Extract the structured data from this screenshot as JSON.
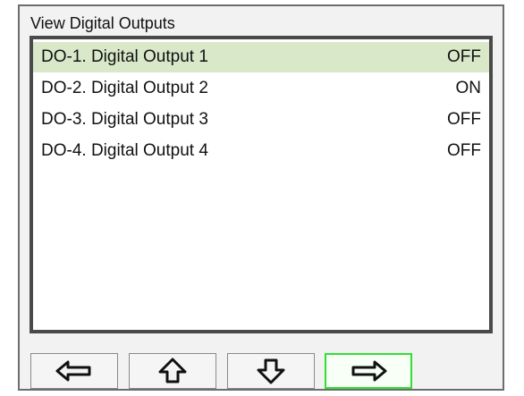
{
  "window": {
    "title": "View Digital Outputs"
  },
  "outputs": [
    {
      "name": "DO-1. Digital Output 1",
      "state": "OFF",
      "selected": true
    },
    {
      "name": "DO-2. Digital Output 2",
      "state": "ON",
      "selected": false
    },
    {
      "name": "DO-3. Digital Output 3",
      "state": "OFF",
      "selected": false
    },
    {
      "name": "DO-4. Digital Output 4",
      "state": "OFF",
      "selected": false
    }
  ],
  "toolbar": {
    "buttons": [
      {
        "icon": "arrow-left-icon",
        "active": false
      },
      {
        "icon": "arrow-up-icon",
        "active": false
      },
      {
        "icon": "arrow-down-icon",
        "active": false
      },
      {
        "icon": "arrow-right-icon",
        "active": true
      }
    ]
  },
  "colors": {
    "selected_row_bg": "#d8e8c9",
    "active_button_border": "#30e030",
    "panel_border": "#4a4a4a"
  }
}
